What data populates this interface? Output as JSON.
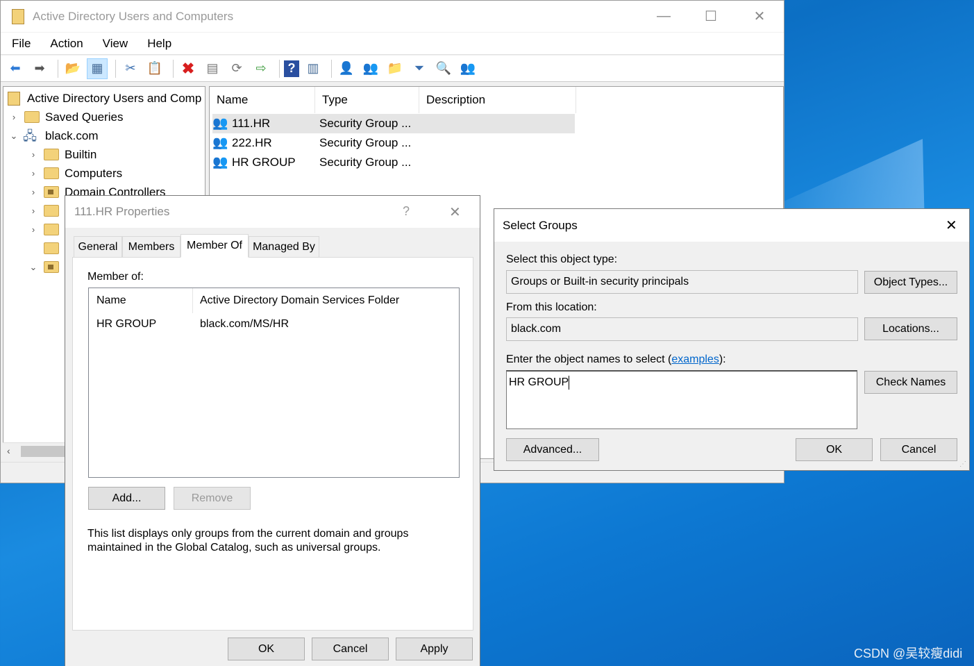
{
  "main_window": {
    "title": "Active Directory Users and Computers",
    "menu": [
      "File",
      "Action",
      "View",
      "Help"
    ],
    "tree": {
      "root": "Active Directory Users and Comp",
      "saved_queries": "Saved Queries",
      "domain": "black.com",
      "builtin": "Builtin",
      "computers": "Computers",
      "domain_controllers": "Domain Controllers"
    },
    "list": {
      "columns": [
        "Name",
        "Type",
        "Description"
      ],
      "rows": [
        {
          "name": "111.HR",
          "type": "Security Group ..."
        },
        {
          "name": "222.HR",
          "type": "Security Group ..."
        },
        {
          "name": "HR GROUP",
          "type": "Security Group ..."
        }
      ]
    },
    "controls": {
      "minimize": "—",
      "maximize": "☐",
      "close": "✕"
    }
  },
  "properties_dialog": {
    "title": "111.HR Properties",
    "help": "?",
    "close": "✕",
    "tabs": [
      "General",
      "Members",
      "Member Of",
      "Managed By"
    ],
    "member_of_label": "Member of:",
    "columns": [
      "Name",
      "Active Directory Domain Services Folder"
    ],
    "rows": [
      {
        "name": "HR GROUP",
        "folder": "black.com/MS/HR"
      }
    ],
    "add_button": "Add...",
    "remove_button": "Remove",
    "note_line1": "This list displays only groups from the current domain and groups",
    "note_line2": "maintained in the Global Catalog, such as universal groups.",
    "ok": "OK",
    "cancel": "Cancel",
    "apply": "Apply"
  },
  "select_groups": {
    "title": "Select Groups",
    "close": "✕",
    "object_type_label": "Select this object type:",
    "object_type_value": "Groups or Built-in security principals",
    "object_types_button": "Object Types...",
    "location_label": "From this location:",
    "location_value": "black.com",
    "locations_button": "Locations...",
    "enter_label_prefix": "Enter the object names to select (",
    "enter_label_link": "examples",
    "enter_label_suffix": "):",
    "names_value": "HR GROUP",
    "check_names_button": "Check Names",
    "advanced_button": "Advanced...",
    "ok": "OK",
    "cancel": "Cancel"
  },
  "watermark": "CSDN @吴较瘦didi"
}
